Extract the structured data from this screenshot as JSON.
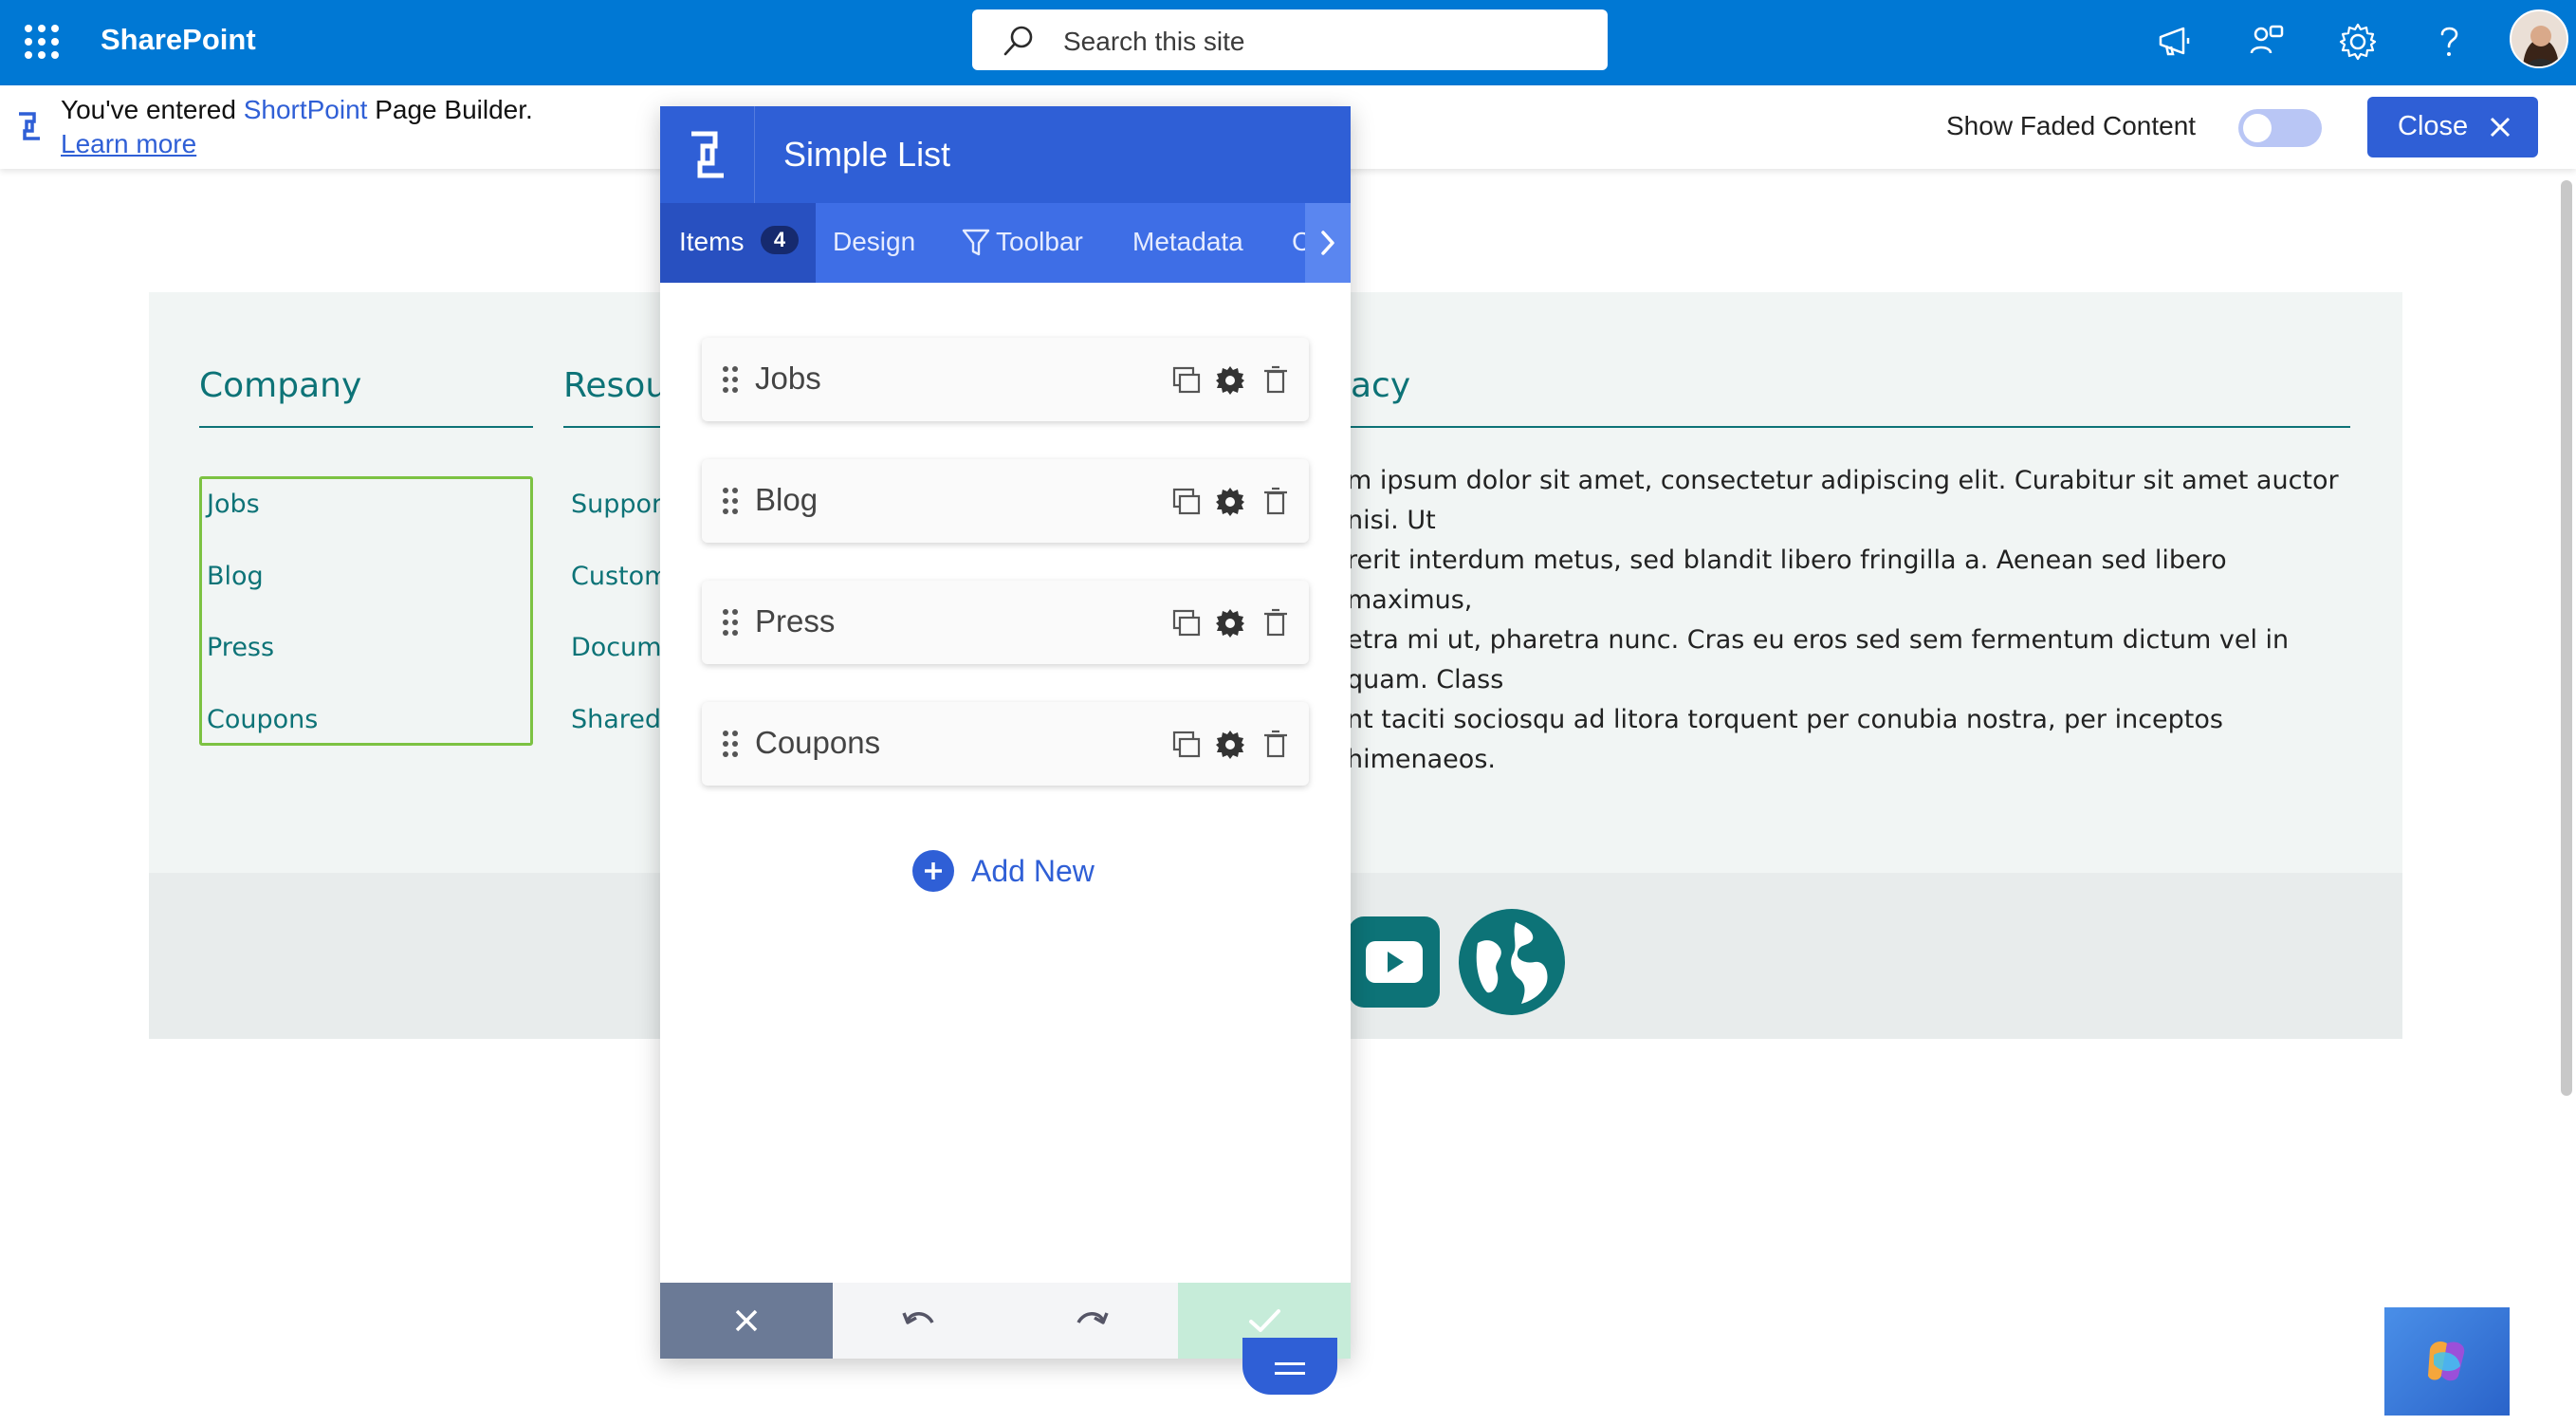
{
  "suitebar": {
    "brand": "SharePoint",
    "search_placeholder": "Search this site",
    "icons": [
      "waffle-icon",
      "megaphone-icon",
      "share-network-icon",
      "gear-icon",
      "help-icon"
    ]
  },
  "builder_bar": {
    "entered_prefix": "You've entered",
    "entered_brand": "ShortPoint",
    "entered_suffix": "Page Builder.",
    "learn_more": "Learn more",
    "faded_label": "Show Faded Content",
    "faded_on": false,
    "close_label": "Close"
  },
  "page": {
    "columns": [
      {
        "title": "Company",
        "links": [
          "Jobs",
          "Blog",
          "Press",
          "Coupons"
        ]
      },
      {
        "title": "Resou",
        "links": [
          "Suppor",
          "Custom",
          "Docume",
          "Shared"
        ]
      },
      {
        "title": "acy",
        "links": []
      }
    ],
    "lorem": "m ipsum dolor sit amet, consectetur adipiscing elit. Curabitur sit amet auctor nisi. Ut\nrerit interdum metus, sed blandit libero fringilla a. Aenean sed libero maximus,\netra mi ut, pharetra nunc. Cras eu eros sed sem fermentum dictum vel in quam. Class\nnt taciti sociosqu ad litora torquent per conubia nostra, per inceptos himenaeos.",
    "social_icons": [
      "youtube-icon",
      "globe-icon"
    ]
  },
  "editor": {
    "title": "Simple List",
    "tabs": [
      {
        "label": "Items",
        "badge": "4",
        "active": true
      },
      {
        "label": "Design"
      },
      {
        "label": "Toolbar"
      },
      {
        "label": "Metadata"
      },
      {
        "label": "C"
      }
    ],
    "items": [
      "Jobs",
      "Blog",
      "Press",
      "Coupons"
    ],
    "add_new": "Add New",
    "footer_buttons": [
      "cancel",
      "undo",
      "redo",
      "apply"
    ]
  },
  "colors": {
    "suitebar": "#0078d4",
    "shortpoint_blue": "#2f5fd6",
    "teal": "#0d7377",
    "selection_green": "#7cc242",
    "footer_cancel": "#6b7a96",
    "footer_apply": "#c6ecd9"
  }
}
